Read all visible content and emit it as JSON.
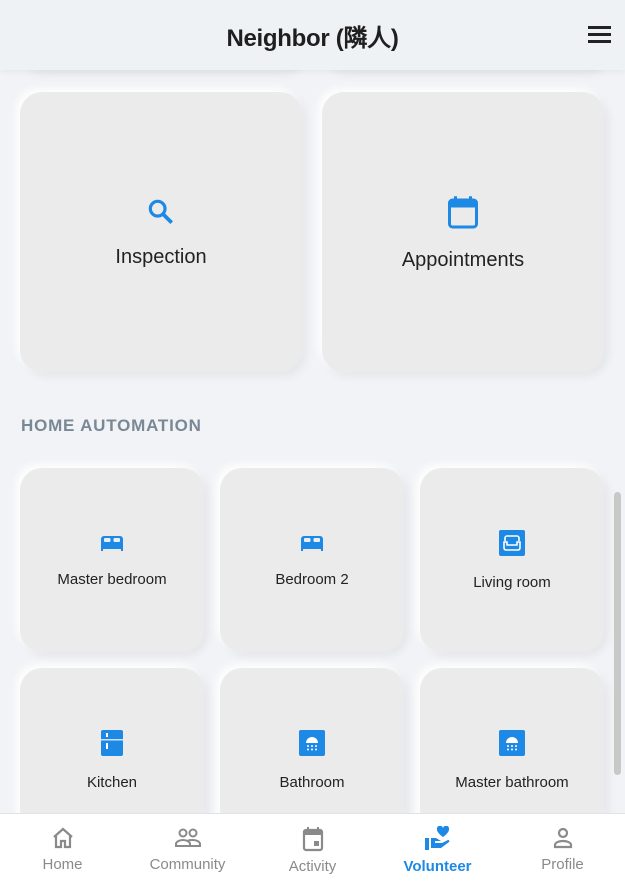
{
  "header": {
    "title": "Neighbor (隣人)"
  },
  "services": [
    {
      "label": "Inspection",
      "icon": "search-icon"
    },
    {
      "label": "Appointments",
      "icon": "calendar-icon"
    }
  ],
  "section_title": "HOME AUTOMATION",
  "rooms": [
    {
      "label": "Master bedroom",
      "icon": "bed-icon"
    },
    {
      "label": "Bedroom 2",
      "icon": "bed-icon"
    },
    {
      "label": "Living room",
      "icon": "sofa-icon"
    },
    {
      "label": "Kitchen",
      "icon": "fridge-icon"
    },
    {
      "label": "Bathroom",
      "icon": "shower-icon"
    },
    {
      "label": "Master bathroom",
      "icon": "shower-icon"
    }
  ],
  "nav": [
    {
      "label": "Home"
    },
    {
      "label": "Community"
    },
    {
      "label": "Activity"
    },
    {
      "label": "Volunteer",
      "active": true
    },
    {
      "label": "Profile"
    }
  ],
  "colors": {
    "accent": "#1e88e5"
  }
}
